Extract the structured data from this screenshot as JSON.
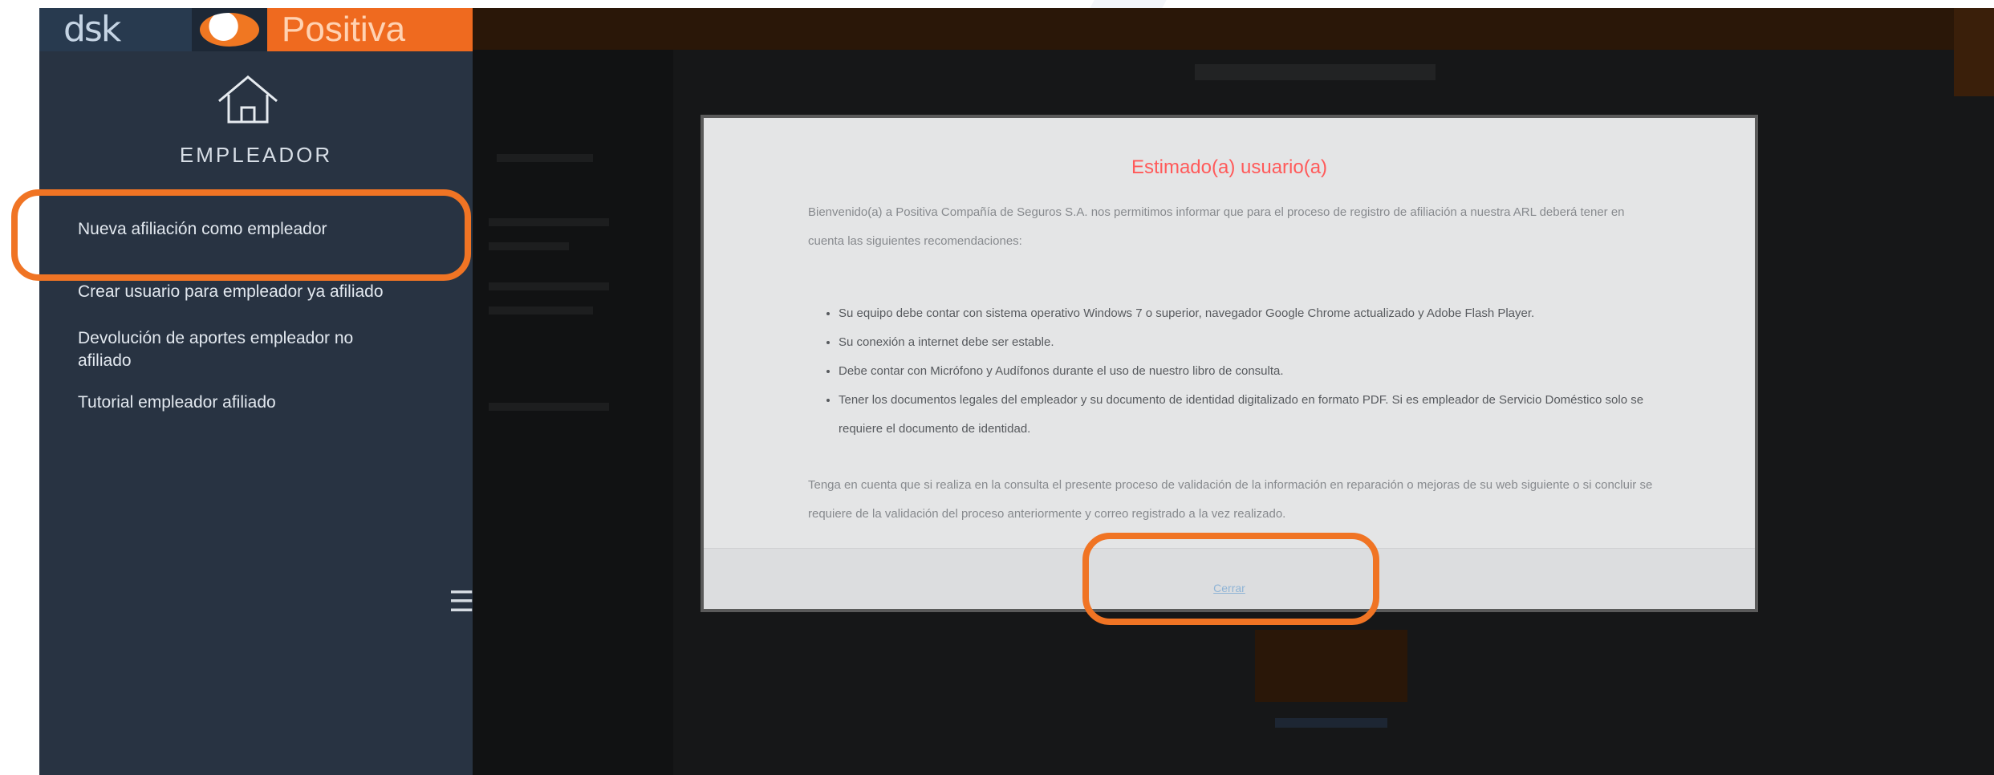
{
  "logo": {
    "left_text": "dsk",
    "brand_text": "Positiva"
  },
  "sidebar": {
    "home_icon": "home-icon",
    "title": "EMPLEADOR",
    "items": [
      {
        "label": "Nueva afiliación como empleador"
      },
      {
        "label": "Crear usuario para empleador ya afiliado"
      },
      {
        "label": "Devolución de aportes empleador no afiliado"
      },
      {
        "label": "Tutorial empleador afiliado"
      }
    ],
    "menu_icon": "hamburger-icon"
  },
  "modal": {
    "title": "Estimado(a) usuario(a)",
    "intro": "Bienvenido(a) a Positiva Compañía de Seguros S.A. nos permitimos informar que para el proceso de registro de afiliación a nuestra ARL deberá tener en cuenta las siguientes recomendaciones:",
    "items": [
      "Su equipo debe contar con sistema operativo Windows 7 o superior, navegador Google Chrome actualizado y Adobe Flash Player.",
      "Su conexión a internet debe ser estable.",
      "Debe contar con Micrófono y Audífonos durante el uso de nuestro libro de consulta.",
      "Tener los documentos legales del empleador y su documento de identidad digitalizado en formato PDF. Si es empleador de Servicio Doméstico solo se requiere el documento de identidad."
    ],
    "note": "Tenga en cuenta que si realiza en la consulta el presente proceso de validación de la información en reparación o mejoras de su web siguiente o si concluir se requiere de la validación del proceso anteriormente y correo registrado a la vez realizado.",
    "close_label": "Cerrar"
  },
  "colors": {
    "highlight": "#f07424",
    "sidebar_bg": "#283342",
    "brand_orange": "#ef6a1f",
    "title_red": "#ff5a5a"
  }
}
